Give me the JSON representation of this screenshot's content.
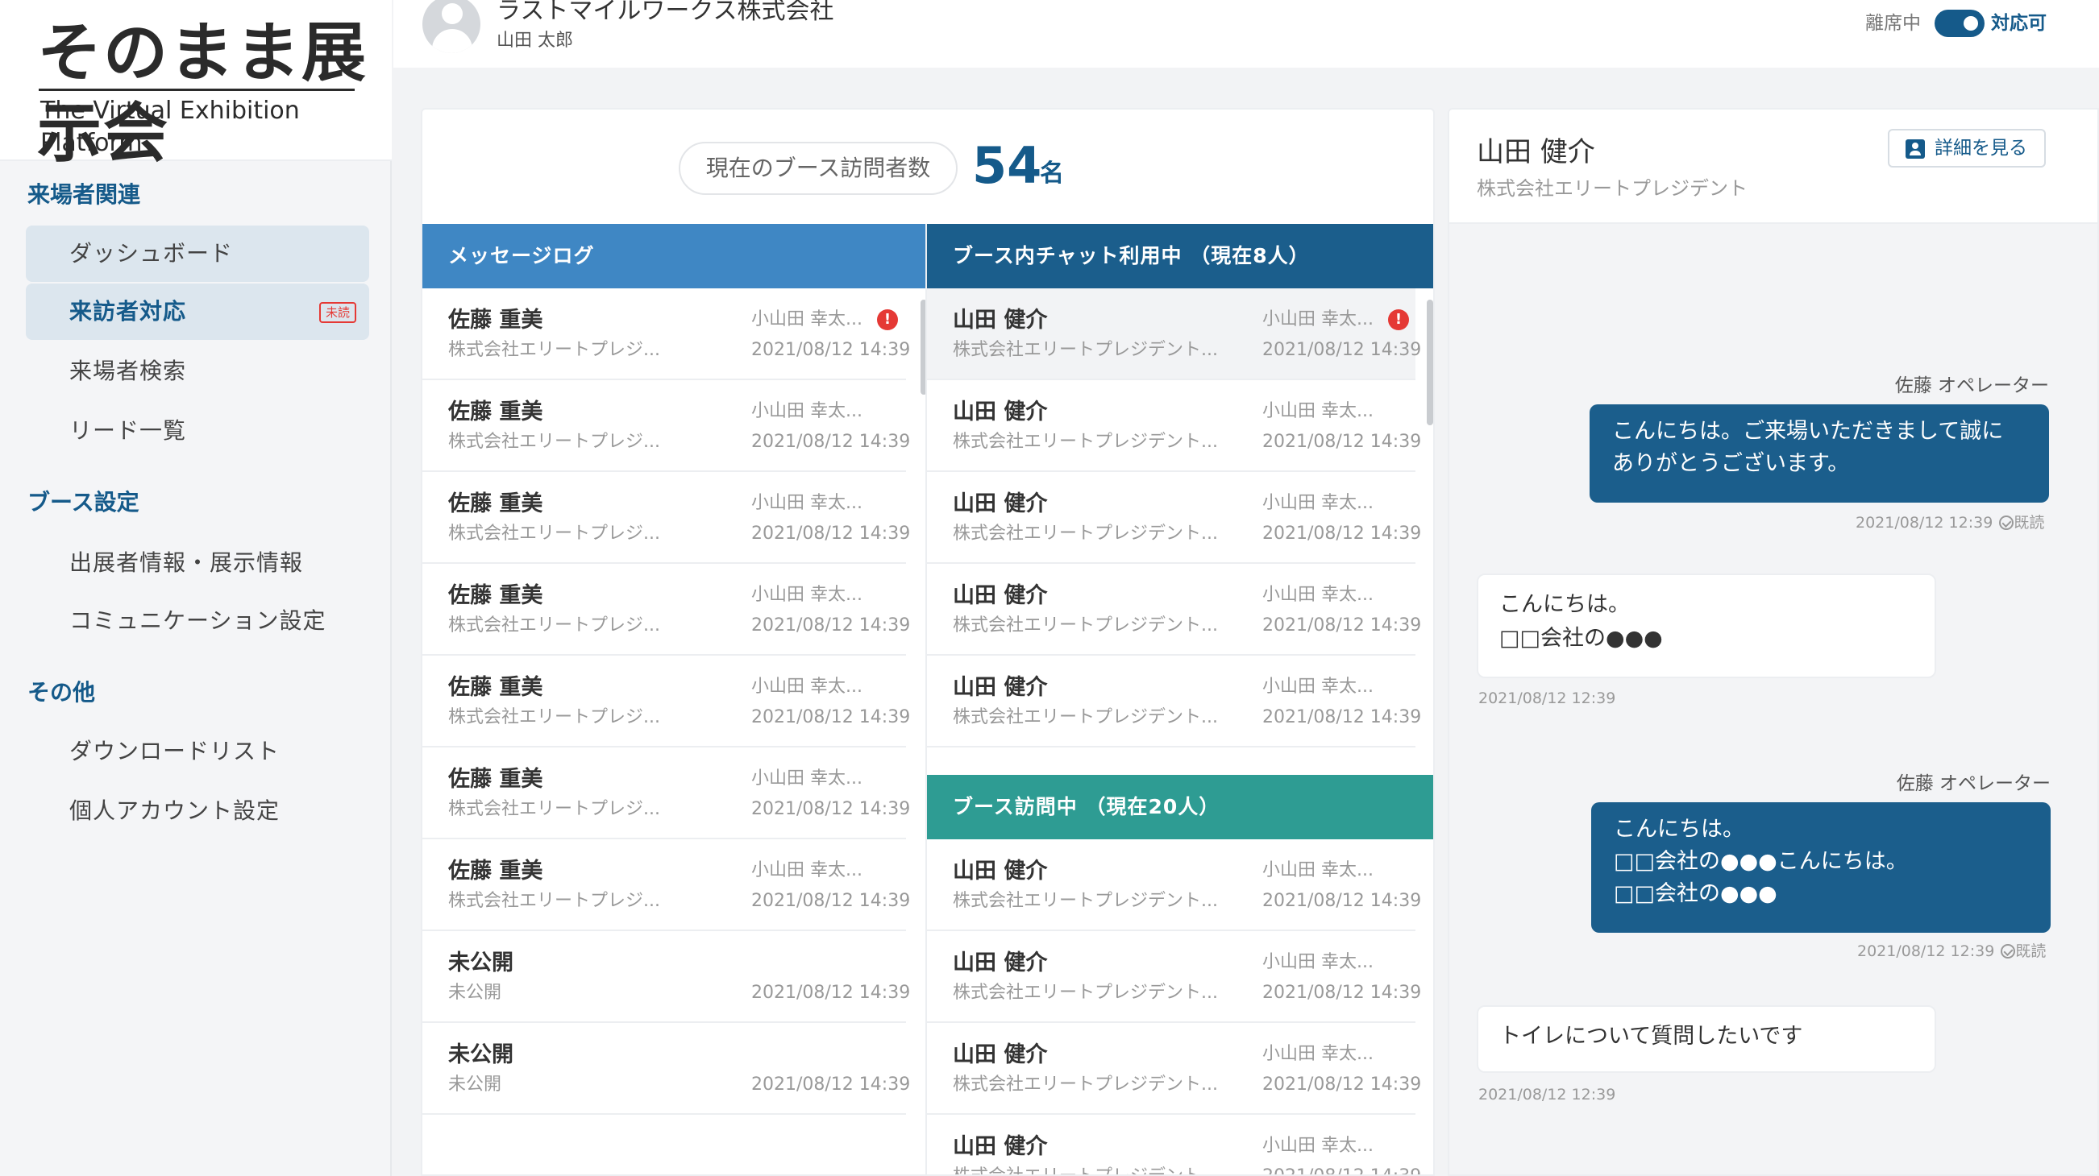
{
  "brand": {
    "title": "そのまま展示会",
    "subtitle": "The Virtual Exhibition Platform"
  },
  "sidebar": {
    "sections": [
      {
        "label": "来場者関連",
        "items": [
          {
            "label": "ダッシュボード"
          },
          {
            "label": "来訪者対応",
            "badge": "未読"
          },
          {
            "label": "来場者検索"
          },
          {
            "label": "リード一覧"
          }
        ]
      },
      {
        "label": "ブース設定",
        "items": [
          {
            "label": "出展者情報・展示情報"
          },
          {
            "label": "コミュニケーション設定"
          }
        ]
      },
      {
        "label": "その他",
        "items": [
          {
            "label": "ダウンロードリスト"
          },
          {
            "label": "個人アカウント設定"
          }
        ]
      }
    ]
  },
  "header": {
    "company": "ラストマイルワークス株式会社",
    "user": "山田 太郎",
    "status_away": "離席中",
    "status_available": "対応可"
  },
  "visitors": {
    "label": "現在のブース訪問者数",
    "count": "54",
    "unit": "名"
  },
  "message_log": {
    "title": "メッセージログ",
    "rows": [
      {
        "name": "佐藤 重美",
        "org": "株式会社エリートプレジ...",
        "operator": "小山田 幸太...",
        "time": "2021/08/12 14:39",
        "alert": true
      },
      {
        "name": "佐藤 重美",
        "org": "株式会社エリートプレジ...",
        "operator": "小山田 幸太...",
        "time": "2021/08/12 14:39"
      },
      {
        "name": "佐藤 重美",
        "org": "株式会社エリートプレジ...",
        "operator": "小山田 幸太...",
        "time": "2021/08/12 14:39"
      },
      {
        "name": "佐藤 重美",
        "org": "株式会社エリートプレジ...",
        "operator": "小山田 幸太...",
        "time": "2021/08/12 14:39"
      },
      {
        "name": "佐藤 重美",
        "org": "株式会社エリートプレジ...",
        "operator": "小山田 幸太...",
        "time": "2021/08/12 14:39"
      },
      {
        "name": "佐藤 重美",
        "org": "株式会社エリートプレジ...",
        "operator": "小山田 幸太...",
        "time": "2021/08/12 14:39"
      },
      {
        "name": "佐藤 重美",
        "org": "株式会社エリートプレジ...",
        "operator": "小山田 幸太...",
        "time": "2021/08/12 14:39"
      },
      {
        "name": "未公開",
        "org": "未公開",
        "operator": "",
        "time": "2021/08/12 14:39"
      },
      {
        "name": "未公開",
        "org": "未公開",
        "operator": "",
        "time": "2021/08/12 14:39"
      }
    ]
  },
  "booth_chat": {
    "title": "ブース内チャット利用中 （現在8人）",
    "rows": [
      {
        "name": "山田 健介",
        "org": "株式会社エリートプレジデント...",
        "operator": "小山田 幸太...",
        "time": "2021/08/12 14:39",
        "alert": true
      },
      {
        "name": "山田 健介",
        "org": "株式会社エリートプレジデント...",
        "operator": "小山田 幸太...",
        "time": "2021/08/12 14:39"
      },
      {
        "name": "山田 健介",
        "org": "株式会社エリートプレジデント...",
        "operator": "小山田 幸太...",
        "time": "2021/08/12 14:39"
      },
      {
        "name": "山田 健介",
        "org": "株式会社エリートプレジデント...",
        "operator": "小山田 幸太...",
        "time": "2021/08/12 14:39"
      },
      {
        "name": "山田 健介",
        "org": "株式会社エリートプレジデント...",
        "operator": "小山田 幸太...",
        "time": "2021/08/12 14:39"
      }
    ]
  },
  "booth_visit": {
    "title": "ブース訪問中 （現在20人）",
    "rows": [
      {
        "name": "山田 健介",
        "org": "株式会社エリートプレジデント...",
        "operator": "小山田 幸太...",
        "time": "2021/08/12 14:39"
      },
      {
        "name": "山田 健介",
        "org": "株式会社エリートプレジデント...",
        "operator": "小山田 幸太...",
        "time": "2021/08/12 14:39"
      },
      {
        "name": "山田 健介",
        "org": "株式会社エリートプレジデント...",
        "operator": "小山田 幸太...",
        "time": "2021/08/12 14:39"
      },
      {
        "name": "山田 健介",
        "org": "株式会社エリートプレジデント...",
        "operator": "小山田 幸太...",
        "time": "2021/08/12 14:39"
      }
    ]
  },
  "chat": {
    "name": "山田 健介",
    "org": "株式会社エリートプレジデント",
    "detail_button": "詳細を見る",
    "messages": [
      {
        "operator": "佐藤 オペレーター",
        "text": "こんにちは。ご来場いただきまして誠に\nありがとうございます。",
        "meta": "2021/08/12 12:39",
        "read": "既読"
      },
      {
        "text": "こんにちは。\n□□会社の●●●",
        "meta": "2021/08/12 12:39"
      },
      {
        "operator": "佐藤 オペレーター",
        "text": "こんにちは。\n□□会社の●●●こんにちは。\n□□会社の●●●",
        "meta": "2021/08/12 12:39",
        "read": "既読"
      },
      {
        "text": "トイレについて質問したいです",
        "meta": "2021/08/12 12:39"
      }
    ]
  },
  "colors": {
    "accent": "#155a8a",
    "log_header": "#3f87c4",
    "chat_header": "#1b5e8c",
    "visit_header": "#2e9c93",
    "alert": "#e53935"
  }
}
